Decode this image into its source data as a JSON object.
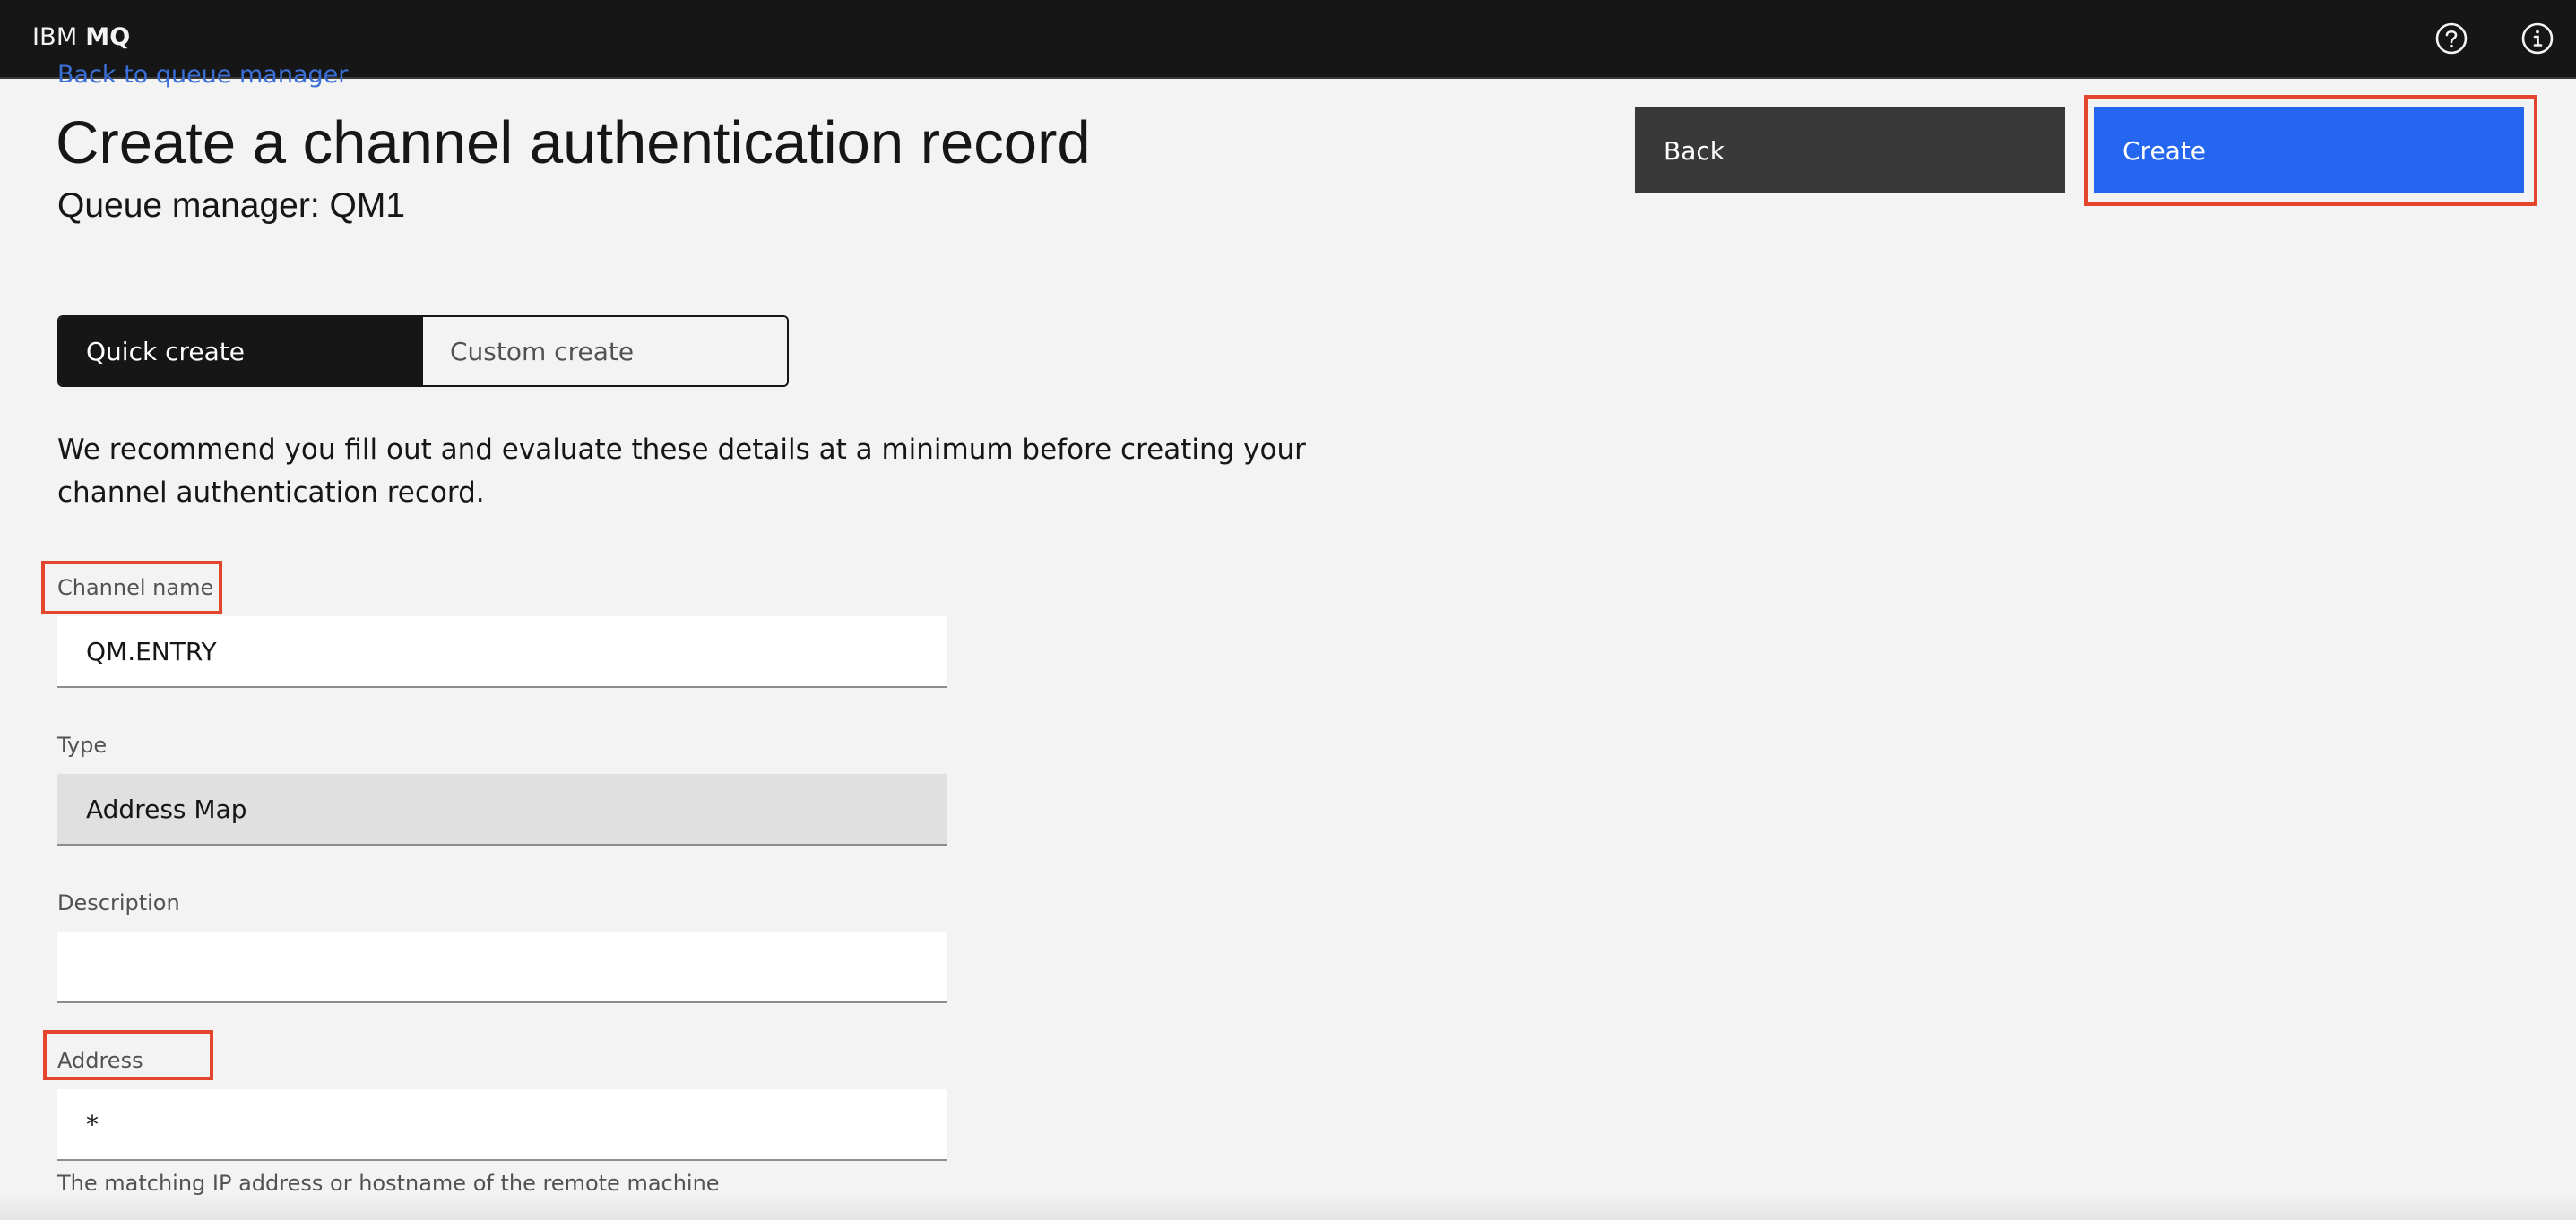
{
  "header": {
    "brand_prefix": "IBM",
    "brand_product": "MQ",
    "icons": [
      "help-icon",
      "info-icon"
    ],
    "background": "#161616"
  },
  "nav": {
    "back_link": "Back to queue manager"
  },
  "page": {
    "title": "Create a channel authentication record",
    "subtitle": "Queue manager: QM1"
  },
  "actions": {
    "back_label": "Back",
    "create_label": "Create",
    "create_color": "#2466f0",
    "back_color": "#393939"
  },
  "create_mode": {
    "tabs": [
      {
        "label": "Quick create",
        "selected": true
      },
      {
        "label": "Custom create",
        "selected": false
      }
    ]
  },
  "intro": "We recommend you fill out and evaluate these details at a minimum before creating your channel authentication record.",
  "form": {
    "channel_name": {
      "label": "Channel name",
      "value": "QM.ENTRY"
    },
    "type": {
      "label": "Type",
      "value": "Address Map"
    },
    "description": {
      "label": "Description",
      "value": ""
    },
    "address": {
      "label": "Address",
      "value": "*",
      "helper": "The matching IP address or hostname of the remote machine"
    }
  },
  "annotation_color": "#e4452d"
}
